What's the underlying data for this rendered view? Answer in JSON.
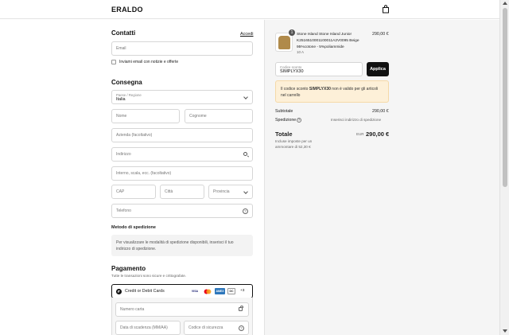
{
  "header": {
    "logo": "ERALDO",
    "bag_icon": "shopping-bag-icon"
  },
  "contact": {
    "title": "Contatti",
    "login_link": "Accedi",
    "email_placeholder": "Email",
    "newsletter_label": "Inviami email con notizie e offerte"
  },
  "shipping": {
    "title": "Consegna",
    "country_label": "Paese / Regione",
    "country_value": "Italia",
    "first_name": "Nome",
    "last_name": "Cognome",
    "company": "Azienda (facoltativo)",
    "address": "Indirizzo",
    "apartment": "Interno, scala, ecc. (facoltativo)",
    "zip": "CAP",
    "city": "Città",
    "province": "Provincia",
    "phone": "Telefono"
  },
  "shipping_method": {
    "title": "Metodo di spedizione",
    "message": "Per visualizzare le modalità di spedizione disponibili, inserisci il tuo indirizzo di spedizione."
  },
  "payment": {
    "title": "Pagamento",
    "subtitle": "Tutte le transazioni sono sicure e crittografate.",
    "method_label": "Credit or Debit Cards",
    "card_brands": [
      "VISA",
      "MC",
      "AMEX",
      "DC"
    ],
    "more_brands": "+3",
    "card_number": "Numero carta",
    "expiry": "Data di scadenza (MM/AA)",
    "cvv": "Codice di sicurezza"
  },
  "summary": {
    "item": {
      "quantity": "1",
      "name": "Stone Island Stone Island Junior K2516510001100011A2V0095 Beige 95%cotone - 5%poliammide",
      "variant": "10 A",
      "price": "290,00 €"
    },
    "discount": {
      "label": "Codice sconto",
      "value": "SIMPLYX30",
      "apply_label": "Applica"
    },
    "alert": {
      "prefix": "Il codice sconto ",
      "code": "SIMPLYX30",
      "suffix": " non è valido per gli articoli nel carrello"
    },
    "subtotal_label": "Subtotale",
    "subtotal_value": "290,00 €",
    "shipping_label": "Spedizione",
    "shipping_value": "Inserisci indirizzo di spedizione",
    "total_label": "Totale",
    "total_currency": "EUR",
    "total_value": "290,00 €",
    "tax_note": "Incluse imposte per un ammontare di 52,30 €"
  },
  "colors": {
    "alert_bg": "#fdf0d8",
    "button_bg": "#111111",
    "sidebar_bg": "#f5f5f5"
  }
}
